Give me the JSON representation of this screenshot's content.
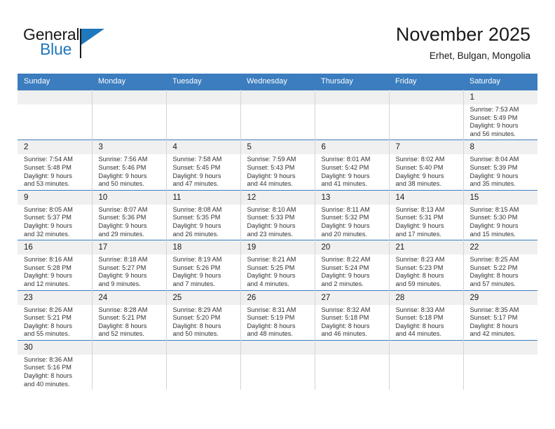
{
  "brand": {
    "name_part1": "General",
    "name_part2": "Blue",
    "accent_color": "#1f77bc"
  },
  "header": {
    "month_title": "November 2025",
    "location": "Erhet, Bulgan, Mongolia",
    "header_bg": "#3b7dbf"
  },
  "weekdays": [
    "Sunday",
    "Monday",
    "Tuesday",
    "Wednesday",
    "Thursday",
    "Friday",
    "Saturday"
  ],
  "labels": {
    "sunrise": "Sunrise:",
    "sunset": "Sunset:",
    "daylight": "Daylight:"
  },
  "weeks": [
    [
      {
        "day": "",
        "blank": true
      },
      {
        "day": "",
        "blank": true
      },
      {
        "day": "",
        "blank": true
      },
      {
        "day": "",
        "blank": true
      },
      {
        "day": "",
        "blank": true
      },
      {
        "day": "",
        "blank": true
      },
      {
        "day": "1",
        "sunrise": "Sunrise: 7:53 AM",
        "sunset": "Sunset: 5:49 PM",
        "daylight_l1": "Daylight: 9 hours",
        "daylight_l2": "and 56 minutes."
      }
    ],
    [
      {
        "day": "2",
        "sunrise": "Sunrise: 7:54 AM",
        "sunset": "Sunset: 5:48 PM",
        "daylight_l1": "Daylight: 9 hours",
        "daylight_l2": "and 53 minutes."
      },
      {
        "day": "3",
        "sunrise": "Sunrise: 7:56 AM",
        "sunset": "Sunset: 5:46 PM",
        "daylight_l1": "Daylight: 9 hours",
        "daylight_l2": "and 50 minutes."
      },
      {
        "day": "4",
        "sunrise": "Sunrise: 7:58 AM",
        "sunset": "Sunset: 5:45 PM",
        "daylight_l1": "Daylight: 9 hours",
        "daylight_l2": "and 47 minutes."
      },
      {
        "day": "5",
        "sunrise": "Sunrise: 7:59 AM",
        "sunset": "Sunset: 5:43 PM",
        "daylight_l1": "Daylight: 9 hours",
        "daylight_l2": "and 44 minutes."
      },
      {
        "day": "6",
        "sunrise": "Sunrise: 8:01 AM",
        "sunset": "Sunset: 5:42 PM",
        "daylight_l1": "Daylight: 9 hours",
        "daylight_l2": "and 41 minutes."
      },
      {
        "day": "7",
        "sunrise": "Sunrise: 8:02 AM",
        "sunset": "Sunset: 5:40 PM",
        "daylight_l1": "Daylight: 9 hours",
        "daylight_l2": "and 38 minutes."
      },
      {
        "day": "8",
        "sunrise": "Sunrise: 8:04 AM",
        "sunset": "Sunset: 5:39 PM",
        "daylight_l1": "Daylight: 9 hours",
        "daylight_l2": "and 35 minutes."
      }
    ],
    [
      {
        "day": "9",
        "sunrise": "Sunrise: 8:05 AM",
        "sunset": "Sunset: 5:37 PM",
        "daylight_l1": "Daylight: 9 hours",
        "daylight_l2": "and 32 minutes."
      },
      {
        "day": "10",
        "sunrise": "Sunrise: 8:07 AM",
        "sunset": "Sunset: 5:36 PM",
        "daylight_l1": "Daylight: 9 hours",
        "daylight_l2": "and 29 minutes."
      },
      {
        "day": "11",
        "sunrise": "Sunrise: 8:08 AM",
        "sunset": "Sunset: 5:35 PM",
        "daylight_l1": "Daylight: 9 hours",
        "daylight_l2": "and 26 minutes."
      },
      {
        "day": "12",
        "sunrise": "Sunrise: 8:10 AM",
        "sunset": "Sunset: 5:33 PM",
        "daylight_l1": "Daylight: 9 hours",
        "daylight_l2": "and 23 minutes."
      },
      {
        "day": "13",
        "sunrise": "Sunrise: 8:11 AM",
        "sunset": "Sunset: 5:32 PM",
        "daylight_l1": "Daylight: 9 hours",
        "daylight_l2": "and 20 minutes."
      },
      {
        "day": "14",
        "sunrise": "Sunrise: 8:13 AM",
        "sunset": "Sunset: 5:31 PM",
        "daylight_l1": "Daylight: 9 hours",
        "daylight_l2": "and 17 minutes."
      },
      {
        "day": "15",
        "sunrise": "Sunrise: 8:15 AM",
        "sunset": "Sunset: 5:30 PM",
        "daylight_l1": "Daylight: 9 hours",
        "daylight_l2": "and 15 minutes."
      }
    ],
    [
      {
        "day": "16",
        "sunrise": "Sunrise: 8:16 AM",
        "sunset": "Sunset: 5:28 PM",
        "daylight_l1": "Daylight: 9 hours",
        "daylight_l2": "and 12 minutes."
      },
      {
        "day": "17",
        "sunrise": "Sunrise: 8:18 AM",
        "sunset": "Sunset: 5:27 PM",
        "daylight_l1": "Daylight: 9 hours",
        "daylight_l2": "and 9 minutes."
      },
      {
        "day": "18",
        "sunrise": "Sunrise: 8:19 AM",
        "sunset": "Sunset: 5:26 PM",
        "daylight_l1": "Daylight: 9 hours",
        "daylight_l2": "and 7 minutes."
      },
      {
        "day": "19",
        "sunrise": "Sunrise: 8:21 AM",
        "sunset": "Sunset: 5:25 PM",
        "daylight_l1": "Daylight: 9 hours",
        "daylight_l2": "and 4 minutes."
      },
      {
        "day": "20",
        "sunrise": "Sunrise: 8:22 AM",
        "sunset": "Sunset: 5:24 PM",
        "daylight_l1": "Daylight: 9 hours",
        "daylight_l2": "and 2 minutes."
      },
      {
        "day": "21",
        "sunrise": "Sunrise: 8:23 AM",
        "sunset": "Sunset: 5:23 PM",
        "daylight_l1": "Daylight: 8 hours",
        "daylight_l2": "and 59 minutes."
      },
      {
        "day": "22",
        "sunrise": "Sunrise: 8:25 AM",
        "sunset": "Sunset: 5:22 PM",
        "daylight_l1": "Daylight: 8 hours",
        "daylight_l2": "and 57 minutes."
      }
    ],
    [
      {
        "day": "23",
        "sunrise": "Sunrise: 8:26 AM",
        "sunset": "Sunset: 5:21 PM",
        "daylight_l1": "Daylight: 8 hours",
        "daylight_l2": "and 55 minutes."
      },
      {
        "day": "24",
        "sunrise": "Sunrise: 8:28 AM",
        "sunset": "Sunset: 5:21 PM",
        "daylight_l1": "Daylight: 8 hours",
        "daylight_l2": "and 52 minutes."
      },
      {
        "day": "25",
        "sunrise": "Sunrise: 8:29 AM",
        "sunset": "Sunset: 5:20 PM",
        "daylight_l1": "Daylight: 8 hours",
        "daylight_l2": "and 50 minutes."
      },
      {
        "day": "26",
        "sunrise": "Sunrise: 8:31 AM",
        "sunset": "Sunset: 5:19 PM",
        "daylight_l1": "Daylight: 8 hours",
        "daylight_l2": "and 48 minutes."
      },
      {
        "day": "27",
        "sunrise": "Sunrise: 8:32 AM",
        "sunset": "Sunset: 5:18 PM",
        "daylight_l1": "Daylight: 8 hours",
        "daylight_l2": "and 46 minutes."
      },
      {
        "day": "28",
        "sunrise": "Sunrise: 8:33 AM",
        "sunset": "Sunset: 5:18 PM",
        "daylight_l1": "Daylight: 8 hours",
        "daylight_l2": "and 44 minutes."
      },
      {
        "day": "29",
        "sunrise": "Sunrise: 8:35 AM",
        "sunset": "Sunset: 5:17 PM",
        "daylight_l1": "Daylight: 8 hours",
        "daylight_l2": "and 42 minutes."
      }
    ],
    [
      {
        "day": "30",
        "sunrise": "Sunrise: 8:36 AM",
        "sunset": "Sunset: 5:16 PM",
        "daylight_l1": "Daylight: 8 hours",
        "daylight_l2": "and 40 minutes."
      },
      {
        "day": "",
        "blank": true
      },
      {
        "day": "",
        "blank": true
      },
      {
        "day": "",
        "blank": true
      },
      {
        "day": "",
        "blank": true
      },
      {
        "day": "",
        "blank": true
      },
      {
        "day": "",
        "blank": true
      }
    ]
  ]
}
